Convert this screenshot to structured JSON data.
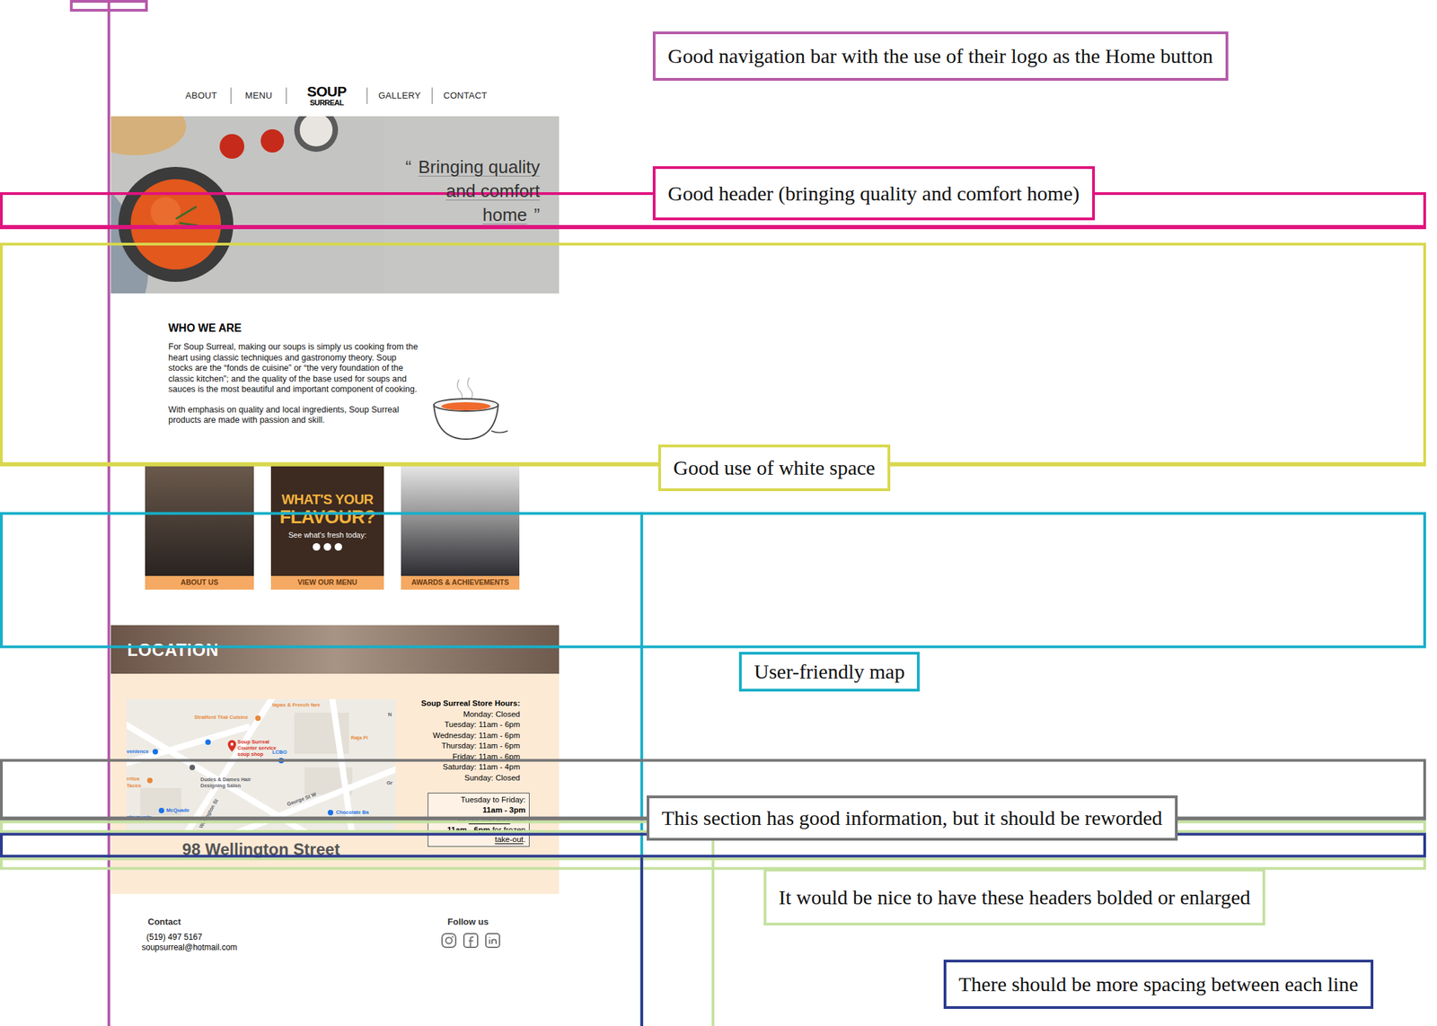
{
  "nav": {
    "left": [
      "ABOUT",
      "MENU"
    ],
    "logo": {
      "line1": "SOUP",
      "line2": "SURREAL"
    },
    "right": [
      "GALLERY",
      "CONTACT"
    ]
  },
  "hero": {
    "quote_open": "“",
    "lines": [
      "Bringing quality",
      "and comfort",
      "home"
    ],
    "quote_close": "”"
  },
  "about": {
    "title": "WHO WE ARE",
    "paragraphs": [
      "For Soup Surreal, making our soups is simply us cooking from the heart using classic techniques and gastronomy theory. Soup stocks are the “fonds de cuisine” or “the very foundation of the classic kitchen”; and the quality of the base used for soups and sauces is the most beautiful and important component of cooking.",
      "With emphasis on quality and local ingredients, Soup Surreal products are made with passion and skill."
    ],
    "cards": [
      {
        "kind": "photo",
        "label": "ABOUT US"
      },
      {
        "kind": "graphic",
        "headline": "WHAT'S YOUR",
        "headline_large": "FLAVOUR?",
        "subtext": "See what's fresh today:",
        "label": "VIEW OUR MENU"
      },
      {
        "kind": "photo",
        "label": "AWARDS & ACHIEVEMENTS"
      }
    ]
  },
  "location": {
    "title": "LOCATION",
    "map": {
      "labels": [
        {
          "text": "tapas & French fare",
          "color": "#e8883a"
        },
        {
          "text": "Stratford Thai Cuisine",
          "color": "#e8883a"
        },
        {
          "text": "Soup Surreal",
          "color": "#d93025"
        },
        {
          "text": "Counter service",
          "color": "#d93025"
        },
        {
          "text": "soup shop",
          "color": "#d93025"
        },
        {
          "text": "LCBO",
          "color": "#1a73e8"
        },
        {
          "text": "Raja Fi",
          "color": "#e8883a"
        },
        {
          "text": "venience",
          "color": "#1a73e8"
        },
        {
          "text": "Dudes & Dames Hair",
          "color": "#5f6368"
        },
        {
          "text": "Designing Salon",
          "color": "#5f6368"
        },
        {
          "text": "rritos",
          "color": "#e8883a"
        },
        {
          "text": "Tacos",
          "color": "#e8883a"
        },
        {
          "text": "McQuade",
          "color": "#1a73e8"
        },
        {
          "text": "struments",
          "color": "#1a73e8"
        },
        {
          "text": "Chocolate Ba",
          "color": "#1a73e8"
        },
        {
          "text": "Wellington St",
          "color": "#5f6368"
        },
        {
          "text": "George St W",
          "color": "#5f6368"
        },
        {
          "text": "N",
          "color": "#5f6368"
        },
        {
          "text": "Gr",
          "color": "#5f6368"
        }
      ]
    },
    "address": "98 Wellington Street",
    "hours_title": "Soup Surreal Store Hours:",
    "hours": [
      "Monday: Closed",
      "Tuesday: 11am - 6pm",
      "Wednesday: 11am - 6pm",
      "Thursday: 11am - 6pm",
      "Friday: 11am - 6pm",
      "Saturday: 11am - 4pm",
      "Sunday: Closed"
    ],
    "takeout": [
      [
        {
          "text": "Tuesday to Friday:",
          "bold": false,
          "underline": false
        }
      ],
      [
        {
          "text": "11am - 3pm",
          "bold": true,
          "underline": false
        }
      ],
      [
        {
          "text": "for ",
          "bold": false,
          "underline": false
        },
        {
          "text": "hot take-out",
          "bold": false,
          "underline": true
        },
        {
          "text": " and",
          "bold": false,
          "underline": false
        }
      ],
      [
        {
          "text": "11am - 6pm",
          "bold": true,
          "underline": false
        },
        {
          "text": " for ",
          "bold": false,
          "underline": false
        },
        {
          "text": "frozen",
          "bold": false,
          "underline": true
        }
      ],
      [
        {
          "text": "take-out",
          "bold": false,
          "underline": true
        },
        {
          "text": ".",
          "bold": false,
          "underline": false
        }
      ]
    ]
  },
  "footer": {
    "contact_title": "Contact",
    "phone": "(519) 497 5167",
    "email": "soupsurreal@hotmail.com",
    "follow_title": "Follow us"
  },
  "annotations": [
    {
      "text": "Good navigation bar with the use of their logo as the Home button",
      "color": "#b55aa9"
    },
    {
      "text": "Good header (bringing quality and comfort home)",
      "color": "#e0137e"
    },
    {
      "text": "Good use of white space",
      "color": "#d8d84c"
    },
    {
      "text": "User-friendly map",
      "color": "#17afc9"
    },
    {
      "text": "This section has good information, but it should be reworded",
      "color": "#767676"
    },
    {
      "text": "It would be nice to have these headers bolded or enlarged",
      "color": "#c5e1a0"
    },
    {
      "text": "There should be more spacing between each line",
      "color": "#2c3b8e"
    }
  ]
}
